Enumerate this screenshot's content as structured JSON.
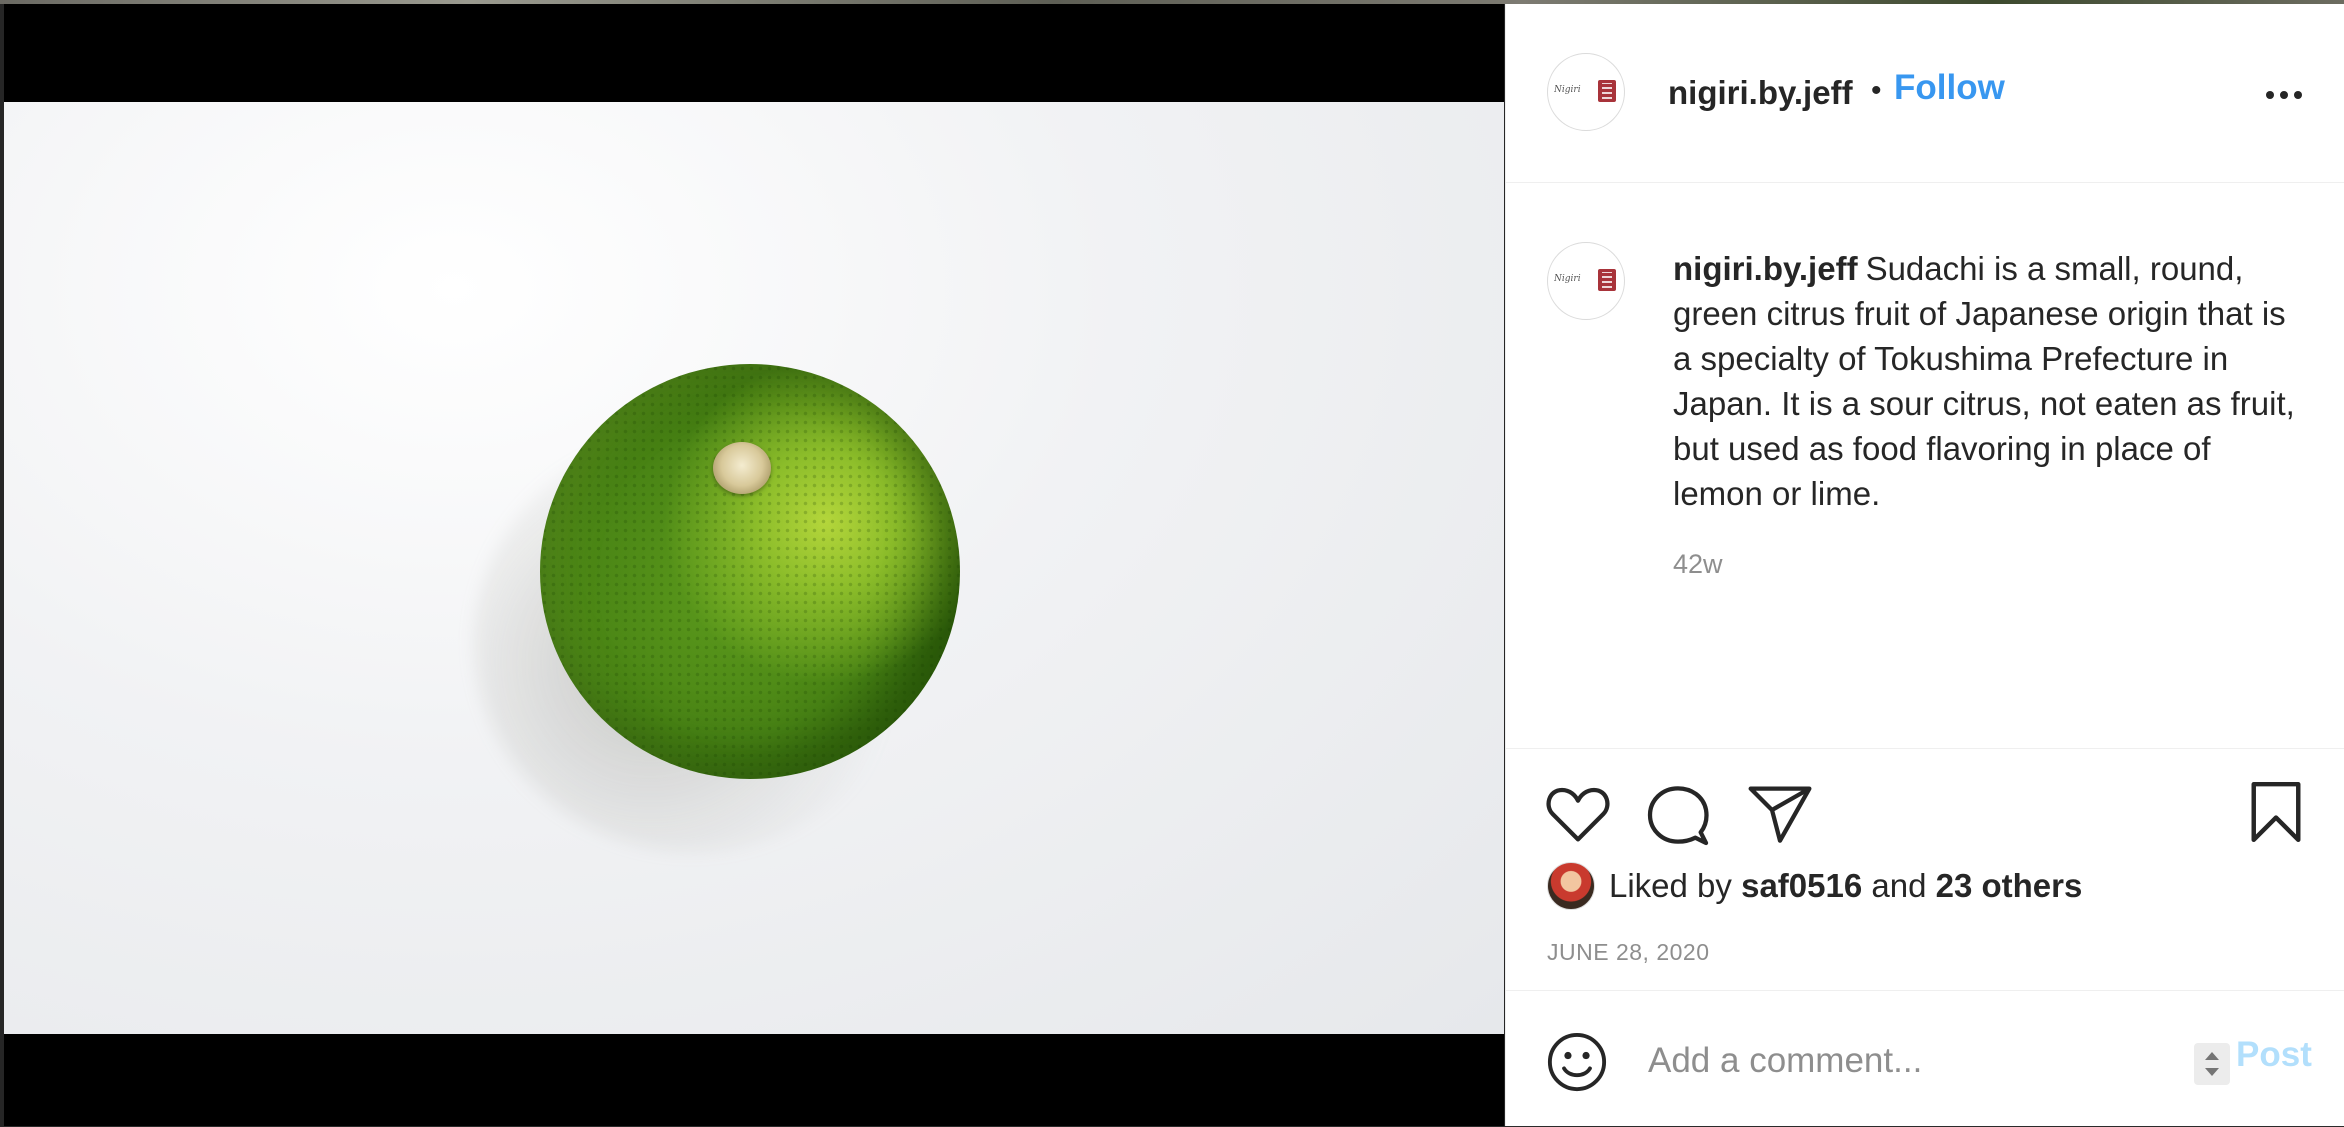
{
  "post": {
    "username": "nigiri.by.jeff",
    "separator": "•",
    "follow_label": "Follow",
    "caption": "Sudachi is a small, round, green citrus fruit of Japanese origin that is a specialty of Tokushima Prefecture in Japan. It is a sour citrus, not eaten as fruit, but used as food flavoring in place of lemon or lime.",
    "age": "42w",
    "date": "JUNE 28, 2020"
  },
  "likes": {
    "prefix": "Liked by",
    "liker": "saf0516",
    "connector": "and",
    "others": "23 others"
  },
  "comment": {
    "placeholder": "Add a comment...",
    "post_label": "Post"
  },
  "icons": {
    "avatar_logo_script": "Nigiri",
    "like": "heart-icon",
    "comment": "comment-bubble-icon",
    "share": "paper-plane-icon",
    "save": "bookmark-icon",
    "emoji": "smiley-icon",
    "more": "ellipsis-icon"
  },
  "colors": {
    "link_blue": "#3897f0",
    "post_disabled": "#b2dffc",
    "text": "#262626",
    "muted": "#8e8e8e"
  }
}
